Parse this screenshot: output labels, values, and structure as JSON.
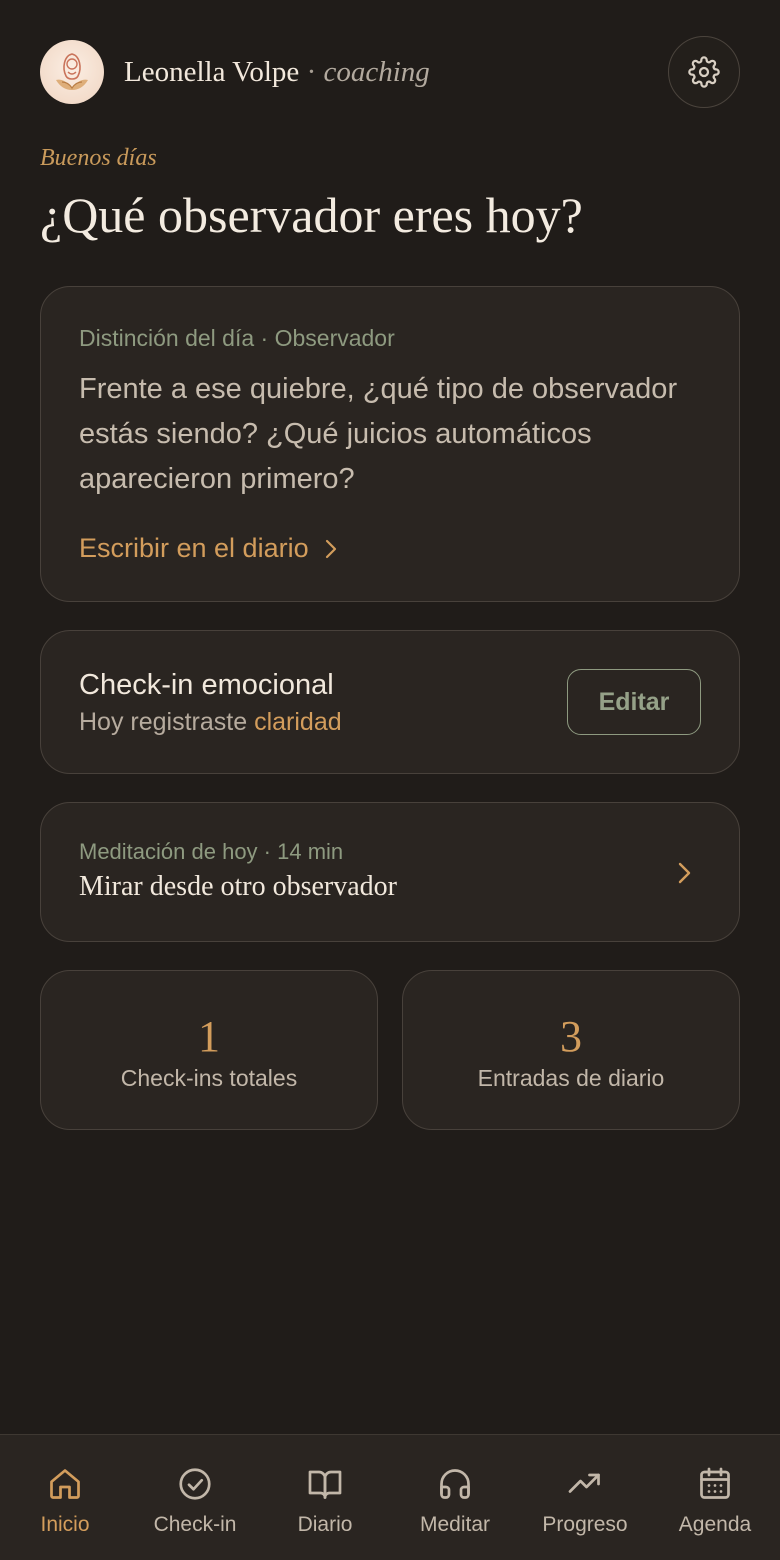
{
  "header": {
    "name": "Leonella Volpe",
    "separator": "·",
    "role": "coaching",
    "settings_icon": "gear-icon"
  },
  "greeting": "Buenos días",
  "headline": "¿Qué observador eres hoy?",
  "distinction": {
    "label": "Distinción del día · Observador",
    "text": "Frente a ese quiebre, ¿qué tipo de observador estás siendo? ¿Qué juicios automáticos aparecieron primero?",
    "link": "Escribir en el diario"
  },
  "checkin": {
    "title": "Check-in emocional",
    "sub_prefix": "Hoy registraste",
    "emotion": "claridad",
    "edit": "Editar"
  },
  "meditation": {
    "label": "Meditación de hoy · 14 min",
    "title": "Mirar desde otro observador"
  },
  "stats": [
    {
      "value": "1",
      "label": "Check-ins totales"
    },
    {
      "value": "3",
      "label": "Entradas de diario"
    }
  ],
  "nav": [
    {
      "label": "Inicio",
      "icon": "home-icon",
      "active": true
    },
    {
      "label": "Check-in",
      "icon": "check-circle-icon",
      "active": false
    },
    {
      "label": "Diario",
      "icon": "book-icon",
      "active": false
    },
    {
      "label": "Meditar",
      "icon": "headphones-icon",
      "active": false
    },
    {
      "label": "Progreso",
      "icon": "trending-up-icon",
      "active": false
    },
    {
      "label": "Agenda",
      "icon": "calendar-icon",
      "active": false
    }
  ],
  "colors": {
    "background": "#201c19",
    "card": "#2a2521",
    "accent": "#d39d5c",
    "sage": "#8e9a80",
    "text": "#f1e8dc"
  }
}
